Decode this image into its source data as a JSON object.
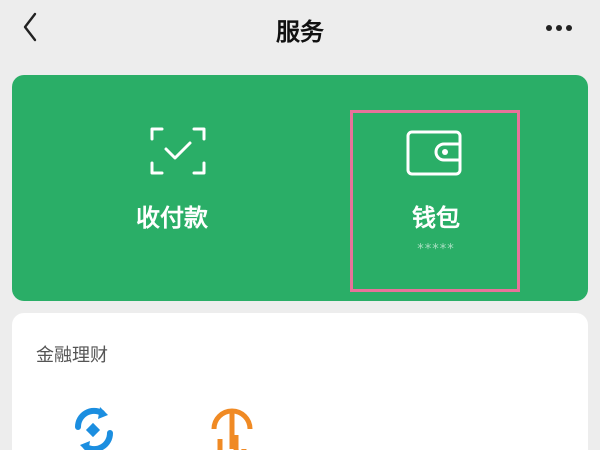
{
  "header": {
    "title": "服务"
  },
  "services": {
    "pay_label": "收付款",
    "wallet_label": "钱包",
    "wallet_balance": "*****"
  },
  "finance": {
    "section_title": "金融理财"
  },
  "colors": {
    "brand_green": "#2aae67",
    "highlight": "#e8729a",
    "blue_icon": "#1b8ee0",
    "orange_icon": "#f08a24"
  }
}
